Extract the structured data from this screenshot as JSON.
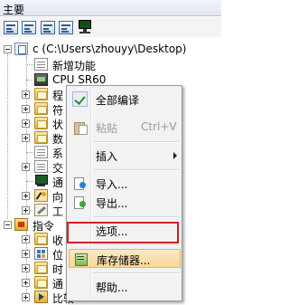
{
  "title": "主要",
  "toolbar": {
    "icons": [
      "view-list-icon",
      "view-details-icon",
      "view-tree-icon",
      "view-props-icon",
      "monitor-icon"
    ]
  },
  "tree": {
    "root_label": "c (C:\\Users\\zhouyy\\Desktop)",
    "new_feature": "新增功能",
    "cpu": "CPU SR60",
    "program_partial": "程",
    "symbol_partial": "符",
    "status_partial": "状",
    "data_partial": "数",
    "system_partial": "系",
    "cross_partial": "交",
    "comm_partial": "通",
    "wizard_partial": "向",
    "tools_partial": "工",
    "instructions": "指令",
    "favorites_partial": "收",
    "bit_partial": "位",
    "clock_partial": "时",
    "comm2_partial": "通",
    "compare": "比较"
  },
  "context_menu": {
    "compile_all": "全部编译",
    "paste": "粘贴",
    "paste_shortcut": "Ctrl+V",
    "insert": "插入",
    "import": "导入...",
    "export": "导出...",
    "options": "选项...",
    "library_memory": "库存储器...",
    "help": "帮助..."
  },
  "colors": {
    "highlight_border": "#d62020",
    "menu_bg": "#f2f2f2"
  }
}
